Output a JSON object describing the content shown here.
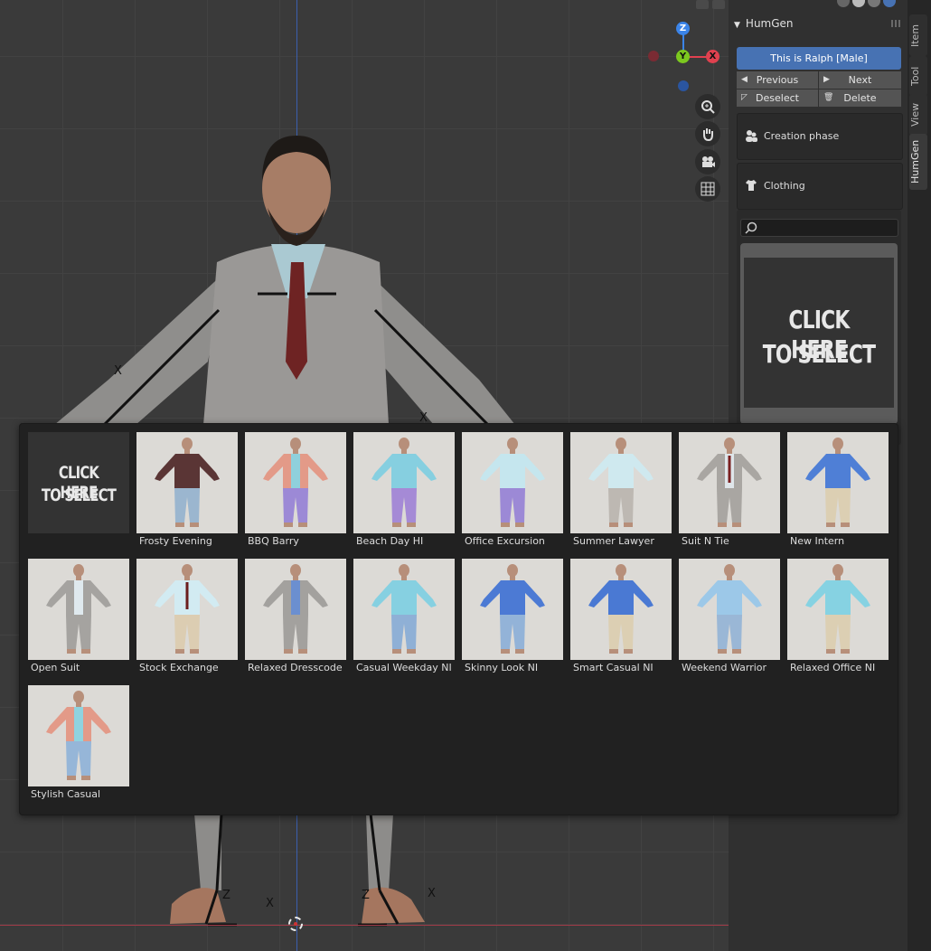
{
  "panel": {
    "title": "HumGen",
    "character_button": "This is Ralph [Male]",
    "previous_label": "Previous",
    "next_label": "Next",
    "deselect_label": "Deselect",
    "delete_label": "Delete",
    "creation_phase_label": "Creation phase",
    "clothing_label": "Clothing",
    "search_placeholder": "",
    "select_text_line1": "CLICK HERE",
    "select_text_line2": "TO SELECT"
  },
  "tabs": [
    {
      "label": "Item"
    },
    {
      "label": "Tool"
    },
    {
      "label": "View"
    },
    {
      "label": "HumGen"
    }
  ],
  "gizmo": {
    "z": "Z",
    "y": "Y",
    "x": "X"
  },
  "popup": {
    "placeholder_line1": "CLICK HERE",
    "placeholder_line2": "TO SELECT",
    "items": [
      {
        "name": "Frosty Evening",
        "top": "#5a3535",
        "pants": "#9bb6cf",
        "shirt": "#5a3535",
        "tie": ""
      },
      {
        "name": "BBQ Barry",
        "top": "#e39a88",
        "pants": "#9c89d6",
        "shirt": "#8fd0dc",
        "tie": ""
      },
      {
        "name": "Beach Day HI",
        "top": "#86cfe0",
        "pants": "#a58ad6",
        "shirt": "#86cfe0",
        "tie": ""
      },
      {
        "name": "Office Excursion",
        "top": "#c5e6ee",
        "pants": "#9c89d6",
        "shirt": "#c5e6ee",
        "tie": ""
      },
      {
        "name": "Summer Lawyer",
        "top": "#cfe9ef",
        "pants": "#bdb8b2",
        "shirt": "#cfe9ef",
        "tie": ""
      },
      {
        "name": "Suit N Tie",
        "top": "#a9a6a2",
        "pants": "#a9a6a2",
        "shirt": "#dfe6ea",
        "tie": "#7a2020"
      },
      {
        "name": "New Intern",
        "top": "#4f7fd6",
        "pants": "#dccfb3",
        "shirt": "#4f7fd6",
        "tie": ""
      },
      {
        "name": "Open Suit",
        "top": "#a5a3a0",
        "pants": "#a5a3a0",
        "shirt": "#dfe9ee",
        "tie": ""
      },
      {
        "name": "Stock Exchange",
        "top": "#d2ebf2",
        "pants": "#dccdb2",
        "shirt": "#d2ebf2",
        "tie": "#6b1d1d"
      },
      {
        "name": "Relaxed Dresscode",
        "top": "#a3a19e",
        "pants": "#a3a19e",
        "shirt": "#6b8fd0",
        "tie": ""
      },
      {
        "name": "Casual Weekday NI",
        "top": "#86d0e1",
        "pants": "#8fb0d6",
        "shirt": "#86d0e1",
        "tie": ""
      },
      {
        "name": "Skinny Look NI",
        "top": "#4c7ad4",
        "pants": "#93b3d8",
        "shirt": "#4c7ad4",
        "tie": ""
      },
      {
        "name": "Smart Casual NI",
        "top": "#4a79d3",
        "pants": "#dccfb3",
        "shirt": "#4a79d3",
        "tie": ""
      },
      {
        "name": "Weekend Warrior",
        "top": "#9cc8e8",
        "pants": "#9ab7d6",
        "shirt": "#9cc8e8",
        "tie": ""
      },
      {
        "name": "Relaxed Office NI",
        "top": "#86d2e2",
        "pants": "#dccfb3",
        "shirt": "#86d2e2",
        "tie": ""
      },
      {
        "name": "Stylish Casual",
        "top": "#e39a88",
        "pants": "#96b6d8",
        "shirt": "#8fd3df",
        "tie": ""
      }
    ]
  },
  "colors": {
    "accent": "#4772b3",
    "axis_x": "#e0414f",
    "axis_y": "#7cc81f",
    "axis_z": "#3b84e8"
  }
}
